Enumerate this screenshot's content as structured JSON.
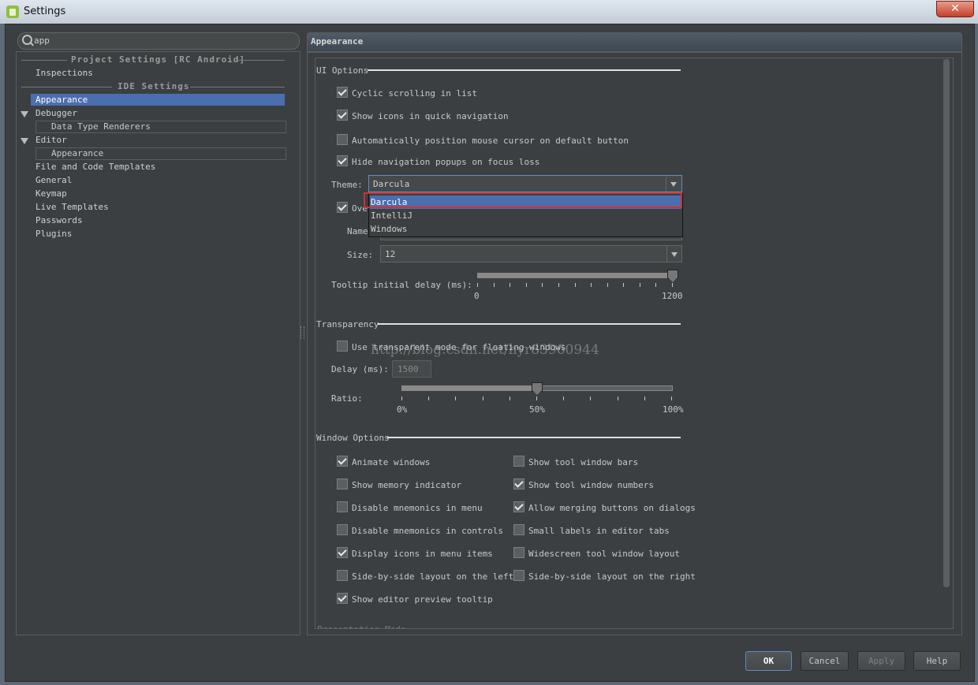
{
  "window": {
    "title": "Settings",
    "close_label": "✕"
  },
  "search": {
    "value": "app"
  },
  "tree": {
    "project_header": "Project Settings [RC Android]",
    "inspections": "Inspections",
    "ide_header": "IDE Settings",
    "appearance": "Appearance",
    "debugger": "Debugger",
    "data_type_renderers": "Data Type Renderers",
    "editor": "Editor",
    "editor_appearance": "Appearance",
    "file_templates": "File and Code Templates",
    "general": "General",
    "keymap": "Keymap",
    "live_templates": "Live Templates",
    "passwords": "Passwords",
    "plugins": "Plugins"
  },
  "panel": {
    "title": "Appearance"
  },
  "ui_options": {
    "title": "UI Options",
    "cyclic": {
      "label": "Cyclic scrolling in list",
      "checked": true
    },
    "show_icons": {
      "label": "Show icons in quick navigation",
      "checked": true
    },
    "auto_position": {
      "label": "Automatically position mouse cursor on default button",
      "checked": false
    },
    "hide_popups": {
      "label": "Hide navigation popups on focus loss",
      "checked": true
    },
    "theme_label": "Theme:",
    "theme_value": "Darcula",
    "theme_options": [
      "Darcula",
      "IntelliJ",
      "Windows"
    ],
    "override_label": "Ove",
    "name_label": "Name",
    "size_label": "Size:",
    "size_value": "12",
    "tooltip_label": "Tooltip initial delay (ms):",
    "tooltip_min": "0",
    "tooltip_max": "1200",
    "tooltip_value": 1200
  },
  "transparency": {
    "title": "Transparency",
    "use_transparent": {
      "label": "Use transparent mode for floating windows",
      "checked": false
    },
    "delay_label": "Delay (ms):",
    "delay_value": "1500",
    "ratio_label": "Ratio:",
    "ratio_ticks": [
      "0%",
      "50%",
      "100%"
    ],
    "ratio_value_percent": 50
  },
  "window_options": {
    "title": "Window Options",
    "left": [
      {
        "label": "Animate windows",
        "checked": true
      },
      {
        "label": "Show memory indicator",
        "checked": false
      },
      {
        "label": "Disable mnemonics in menu",
        "checked": false
      },
      {
        "label": "Disable mnemonics in controls",
        "checked": false
      },
      {
        "label": "Display icons in menu items",
        "checked": true
      },
      {
        "label": "Side-by-side layout on the left",
        "checked": false
      },
      {
        "label": "Show editor preview tooltip",
        "checked": true
      }
    ],
    "right": [
      {
        "label": "Show tool window bars",
        "checked": false
      },
      {
        "label": "Show tool window numbers",
        "checked": true
      },
      {
        "label": "Allow merging buttons on dialogs",
        "checked": true
      },
      {
        "label": "Small labels in editor tabs",
        "checked": false
      },
      {
        "label": "Widescreen tool window layout",
        "checked": false
      },
      {
        "label": "Side-by-side layout on the right",
        "checked": false
      }
    ]
  },
  "watermark": "http://blog.csdn.net/hyr83960944",
  "buttons": {
    "ok": "OK",
    "cancel": "Cancel",
    "apply": "Apply",
    "help": "Help"
  }
}
